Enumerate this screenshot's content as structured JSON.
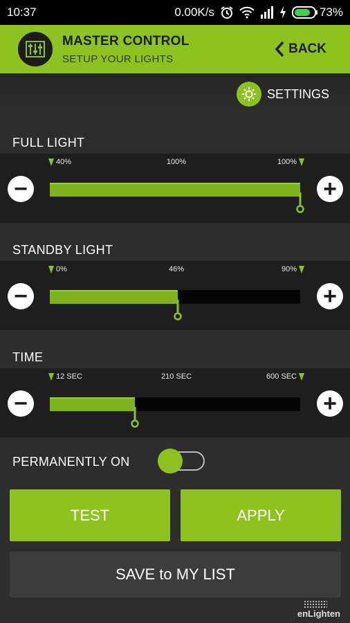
{
  "status_bar": {
    "time": "10:37",
    "network_speed": "0.00K/s",
    "battery": "73%",
    "icons": [
      "alarm-icon",
      "wifi-icon",
      "signal-icon",
      "charging-icon",
      "battery-icon"
    ]
  },
  "header": {
    "title": "MASTER CONTROL",
    "subtitle": "SETUP YOUR LIGHTS",
    "back_label": "BACK",
    "accent": "#8dc21f"
  },
  "settings": {
    "label": "SETTINGS"
  },
  "sliders": [
    {
      "label": "FULL LIGHT",
      "min_label": "40%",
      "mid_label": "100%",
      "max_label": "100%",
      "value_fraction": 1.0
    },
    {
      "label": "STANDBY LIGHT",
      "min_label": "0%",
      "mid_label": "46%",
      "max_label": "90%",
      "value_fraction": 0.51
    },
    {
      "label": "TIME",
      "min_label": "12 SEC",
      "mid_label": "210 SEC",
      "max_label": "600 SEC",
      "value_fraction": 0.34
    }
  ],
  "permanently_on": {
    "label": "PERMANENTLY ON",
    "checked": true
  },
  "buttons": {
    "test": "TEST",
    "apply": "APPLY",
    "save": "SAVE to MY LIST"
  },
  "brand": "enLighten"
}
